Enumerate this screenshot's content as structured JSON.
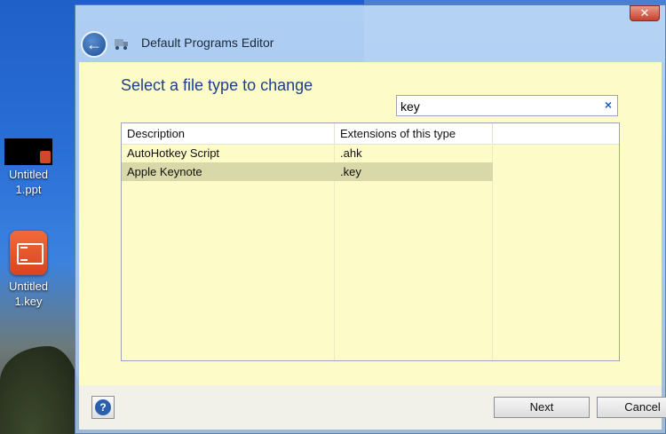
{
  "desktop": {
    "icons": [
      {
        "label_line1": "Untitled",
        "label_line2": "1.ppt"
      },
      {
        "label_line1": "Untitled",
        "label_line2": "1.key"
      }
    ]
  },
  "window": {
    "title": "Default Programs Editor",
    "back_icon": "back-arrow-icon",
    "close_glyph": "✕"
  },
  "page": {
    "heading": "Select a file type to change",
    "search": {
      "value": "key",
      "clear_glyph": "×"
    }
  },
  "table": {
    "columns": [
      "Description",
      "Extensions of this type"
    ],
    "rows": [
      {
        "description": "AutoHotkey Script",
        "extension": ".ahk",
        "selected": false
      },
      {
        "description": "Apple Keynote",
        "extension": ".key",
        "selected": true
      }
    ]
  },
  "footer": {
    "help_glyph": "?",
    "next_label": "Next",
    "cancel_label": "Cancel"
  },
  "colors": {
    "content_bg": "#fdfbc8",
    "selected_row": "#d9d8a8",
    "heading": "#1e3f8a"
  }
}
